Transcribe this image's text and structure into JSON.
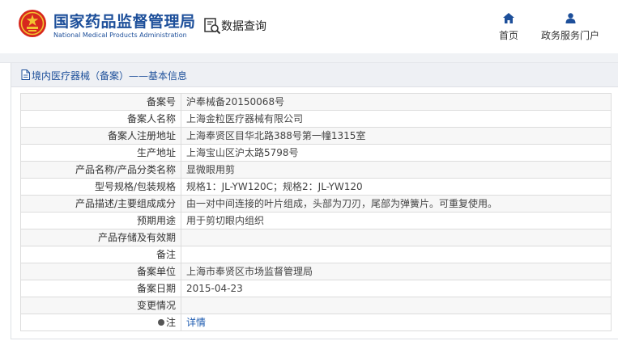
{
  "header": {
    "brand_cn": "国家药品监督管理局",
    "brand_en": "National Medical Products Administration",
    "query_label": "数据查询",
    "nav": [
      {
        "label": "首页",
        "icon": "home-icon"
      },
      {
        "label": "政务服务门户",
        "icon": "user-icon"
      }
    ]
  },
  "panel": {
    "title": "境内医疗器械（备案）——基本信息"
  },
  "rows": [
    {
      "key": "备案号",
      "value": "沪奉械备20150068号"
    },
    {
      "key": "备案人名称",
      "value": "上海金粒医疗器械有限公司"
    },
    {
      "key": "备案人注册地址",
      "value": "上海奉贤区目华北路388号第一幢1315室"
    },
    {
      "key": "生产地址",
      "value": "上海宝山区沪太路5798号"
    },
    {
      "key": "产品名称/产品分类名称",
      "value": "显微眼用剪"
    },
    {
      "key": "型号规格/包装规格",
      "value": "规格1：JL-YW120C；规格2：JL-YW120"
    },
    {
      "key": "产品描述/主要组成成分",
      "value": "由一对中间连接的叶片组成，头部为刀刃，尾部为弹簧片。可重复使用。"
    },
    {
      "key": "预期用途",
      "value": "用于剪切眼内组织"
    },
    {
      "key": "产品存储及有效期",
      "value": ""
    },
    {
      "key": "备注",
      "value": ""
    },
    {
      "key": "备案单位",
      "value": "上海市奉贤区市场监督管理局"
    },
    {
      "key": "备案日期",
      "value": "2015-04-23"
    },
    {
      "key": "变更情况",
      "value": ""
    },
    {
      "key": "注",
      "value": "详情"
    }
  ],
  "colors": {
    "brand_blue": "#1d4f9a",
    "emblem_red": "#d7281e",
    "emblem_gold": "#f2c231",
    "link_blue": "#1d5bb0"
  }
}
